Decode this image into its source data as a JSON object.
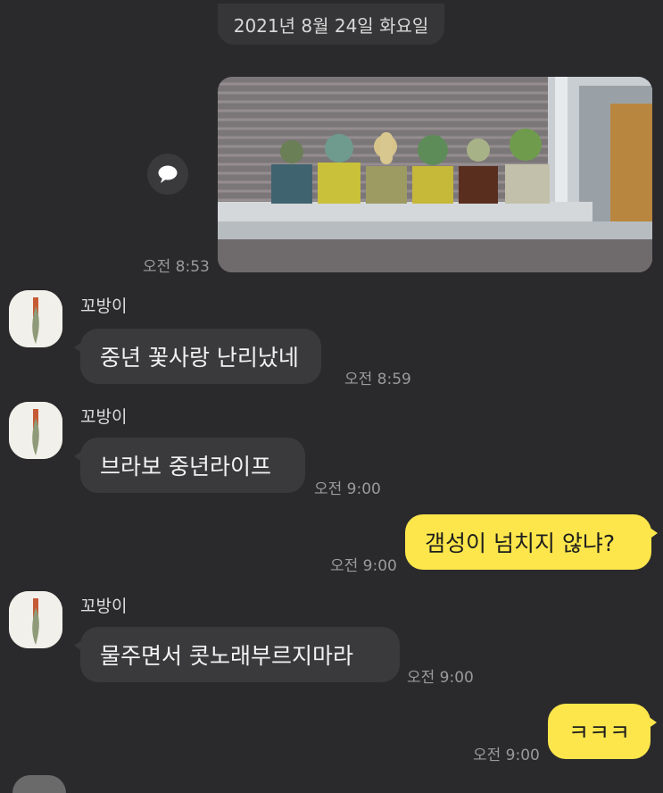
{
  "date_divider": "2021년 8월 24일 화요일",
  "messages": [
    {
      "from": "me",
      "type": "image",
      "time": "오전 8:53"
    },
    {
      "from": "꼬방이",
      "text": "중년 꽃사랑 난리났네",
      "time": "오전 8:59"
    },
    {
      "from": "꼬방이",
      "text": "브라보 중년라이프",
      "time": "오전 9:00"
    },
    {
      "from": "me",
      "text": "갬성이 넘치지 않냐?",
      "time": "오전 9:00"
    },
    {
      "from": "꼬방이",
      "text": "물주면서 콧노래부르지마라",
      "time": "오전 9:00"
    },
    {
      "from": "me",
      "text": "ㅋㅋㅋ",
      "time": "오전 9:00"
    }
  ],
  "colors": {
    "background": "#2a2a2c",
    "bubble_other": "#3a3a3c",
    "bubble_me": "#fde64b"
  },
  "icons": {
    "share": "speech-bubble-icon"
  }
}
